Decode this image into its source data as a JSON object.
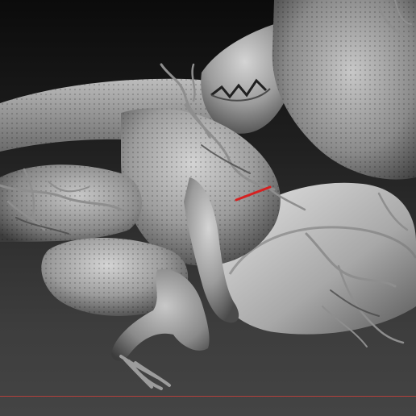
{
  "viewport": {
    "background_top": "#0b0b0b",
    "background_bottom": "#444444",
    "ground_line_color": "#b3413c"
  },
  "model": {
    "material_base": "#9a9a9a",
    "material_highlight": "#cfcfcf",
    "material_shadow": "#3a3a3a",
    "stroke_accent": "#d62020"
  }
}
